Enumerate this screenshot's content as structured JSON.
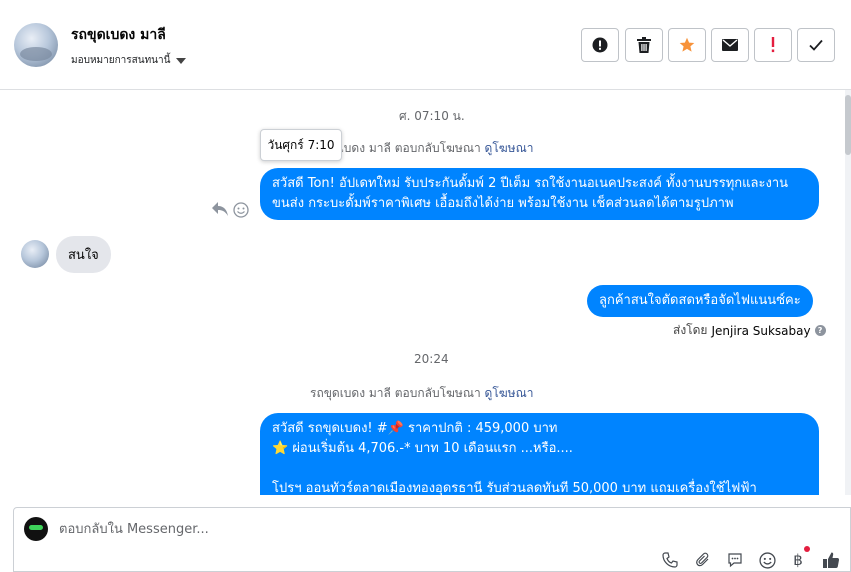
{
  "header": {
    "contact_name": "รถขุดเบดง มาลี",
    "assign_label": "มอบหมายการสนทนานี้"
  },
  "toolbar": {
    "buttons": [
      {
        "name": "spam-alert",
        "icon": "exclamation-circle-icon"
      },
      {
        "name": "delete",
        "icon": "trash-icon"
      },
      {
        "name": "star",
        "icon": "star-icon",
        "color": "#f7923a"
      },
      {
        "name": "mark-unread",
        "icon": "envelope-icon"
      },
      {
        "name": "follow-up",
        "icon": "exclamation-icon",
        "color": "#e41e3f"
      },
      {
        "name": "done",
        "icon": "check-icon"
      }
    ]
  },
  "thread": {
    "timestamp_1": "ศ. 07:10 น.",
    "tooltip": "วันศุกร์ 7:10",
    "reply_note_1_prefix": "รถขุดเบดง มาลี ตอบกลับโฆษณา",
    "reply_note_1_link": "ดูโฆษณา",
    "message_1": "สวัสดี Ton! อัปเดทใหม่ รับประกันดั้มพ์ 2 ปีเต็ม รถใช้งานอเนคประสงค์ ทั้งงานบรรทุกและงานขนส่ง กระบะดั้มพ์ราคาพิเศษ เอื้อมถึงได้ง่าย พร้อมใช้งาน เช็คส่วนลดได้ตามรูปภาพ",
    "message_2": "สนใจ",
    "message_3": "ลูกค้าสนใจตัดสดหรือจัดไฟแนนซ์คะ",
    "sent_by_label": "ส่งโดย",
    "sent_by_name": "Jenjira Suksabay",
    "timestamp_2": "20:24",
    "reply_note_2_prefix": "รถขุดเบดง มาลี ตอบกลับโฆษณา",
    "reply_note_2_link": "ดูโฆษณา",
    "message_4_line1": "สวัสดี รถขุดเบดง! #📌 ราคาปกติ : 459,000 บาท",
    "message_4_line2": "⭐ ผ่อนเริ่มต้น 4,706.-* บาท 10 เดือนแรก ...หรือ....",
    "message_4_line3": "โปรฯ ออนทัวร์ตลาดเมืองทองอุดรธานี  รับส่วนลดทันที 50,000 บาท แถมเครื่องใช้ไฟฟ้า"
  },
  "composer": {
    "placeholder": "ตอบกลับใน Messenger...",
    "icons": [
      "phone-icon",
      "paperclip-icon",
      "saved-replies-icon",
      "emoji-icon",
      "baht-payment-icon",
      "like-icon"
    ]
  },
  "colors": {
    "outgoing_bubble": "#0084ff",
    "incoming_bubble": "#e4e6eb",
    "link": "#385898"
  }
}
